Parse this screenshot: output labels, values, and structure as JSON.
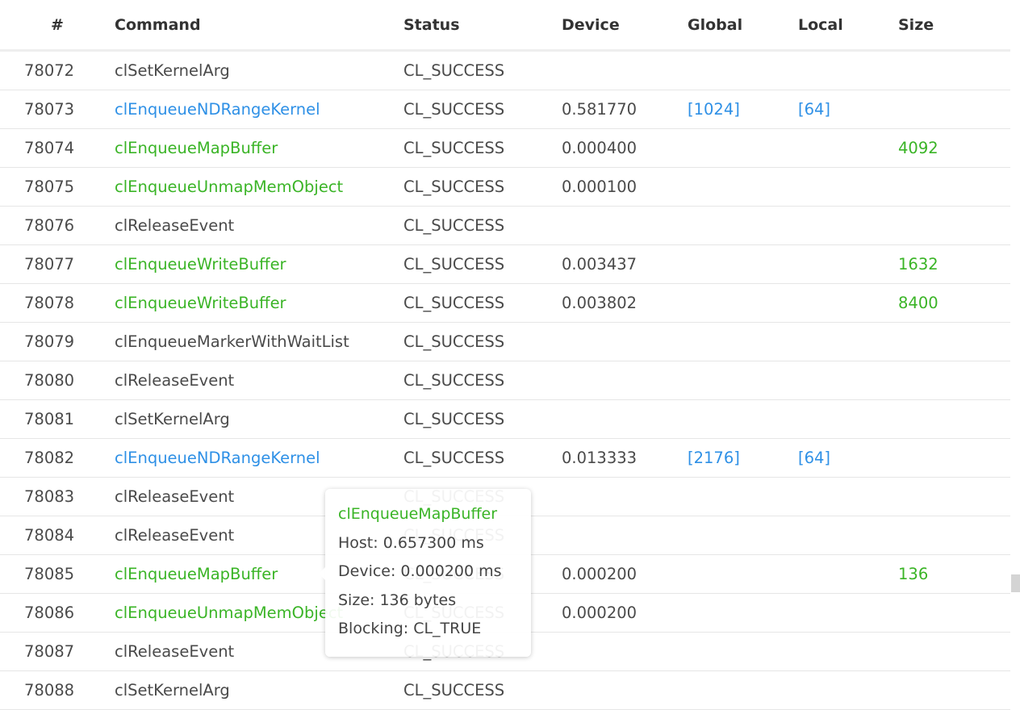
{
  "columns": [
    "#",
    "Command",
    "Status",
    "Device",
    "Global",
    "Local",
    "Size"
  ],
  "colors": {
    "kernel": "#2e90e6",
    "memory": "#3ab426",
    "text": "#4a4a4a"
  },
  "rows": [
    {
      "id": "78072",
      "command": "clSetKernelArg",
      "kind": "plain",
      "status": "CL_SUCCESS",
      "device": "",
      "global": "",
      "local": "",
      "size": ""
    },
    {
      "id": "78073",
      "command": "clEnqueueNDRangeKernel",
      "kind": "kernel",
      "status": "CL_SUCCESS",
      "device": "0.581770",
      "global": "[1024]",
      "local": "[64]",
      "size": ""
    },
    {
      "id": "78074",
      "command": "clEnqueueMapBuffer",
      "kind": "memory",
      "status": "CL_SUCCESS",
      "device": "0.000400",
      "global": "",
      "local": "",
      "size": "4092"
    },
    {
      "id": "78075",
      "command": "clEnqueueUnmapMemObject",
      "kind": "memory",
      "status": "CL_SUCCESS",
      "device": "0.000100",
      "global": "",
      "local": "",
      "size": ""
    },
    {
      "id": "78076",
      "command": "clReleaseEvent",
      "kind": "plain",
      "status": "CL_SUCCESS",
      "device": "",
      "global": "",
      "local": "",
      "size": ""
    },
    {
      "id": "78077",
      "command": "clEnqueueWriteBuffer",
      "kind": "memory",
      "status": "CL_SUCCESS",
      "device": "0.003437",
      "global": "",
      "local": "",
      "size": "1632"
    },
    {
      "id": "78078",
      "command": "clEnqueueWriteBuffer",
      "kind": "memory",
      "status": "CL_SUCCESS",
      "device": "0.003802",
      "global": "",
      "local": "",
      "size": "8400"
    },
    {
      "id": "78079",
      "command": "clEnqueueMarkerWithWaitList",
      "kind": "plain",
      "status": "CL_SUCCESS",
      "device": "",
      "global": "",
      "local": "",
      "size": ""
    },
    {
      "id": "78080",
      "command": "clReleaseEvent",
      "kind": "plain",
      "status": "CL_SUCCESS",
      "device": "",
      "global": "",
      "local": "",
      "size": ""
    },
    {
      "id": "78081",
      "command": "clSetKernelArg",
      "kind": "plain",
      "status": "CL_SUCCESS",
      "device": "",
      "global": "",
      "local": "",
      "size": ""
    },
    {
      "id": "78082",
      "command": "clEnqueueNDRangeKernel",
      "kind": "kernel",
      "status": "CL_SUCCESS",
      "device": "0.013333",
      "global": "[2176]",
      "local": "[64]",
      "size": ""
    },
    {
      "id": "78083",
      "command": "clReleaseEvent",
      "kind": "plain",
      "status": "CL_SUCCESS",
      "device": "",
      "global": "",
      "local": "",
      "size": ""
    },
    {
      "id": "78084",
      "command": "clReleaseEvent",
      "kind": "plain",
      "status": "CL_SUCCESS",
      "device": "",
      "global": "",
      "local": "",
      "size": ""
    },
    {
      "id": "78085",
      "command": "clEnqueueMapBuffer",
      "kind": "memory",
      "status": "CL_SUCCESS",
      "device": "0.000200",
      "global": "",
      "local": "",
      "size": "136"
    },
    {
      "id": "78086",
      "command": "clEnqueueUnmapMemObject",
      "kind": "memory",
      "status": "CL_SUCCESS",
      "device": "0.000200",
      "global": "",
      "local": "",
      "size": ""
    },
    {
      "id": "78087",
      "command": "clReleaseEvent",
      "kind": "plain",
      "status": "CL_SUCCESS",
      "device": "",
      "global": "",
      "local": "",
      "size": ""
    },
    {
      "id": "78088",
      "command": "clSetKernelArg",
      "kind": "plain",
      "status": "CL_SUCCESS",
      "device": "",
      "global": "",
      "local": "",
      "size": ""
    }
  ],
  "tooltip": {
    "title": "clEnqueueMapBuffer",
    "host": "Host: 0.657300 ms",
    "device": "Device: 0.000200 ms",
    "size": "Size: 136 bytes",
    "blocking": "Blocking: CL_TRUE"
  }
}
